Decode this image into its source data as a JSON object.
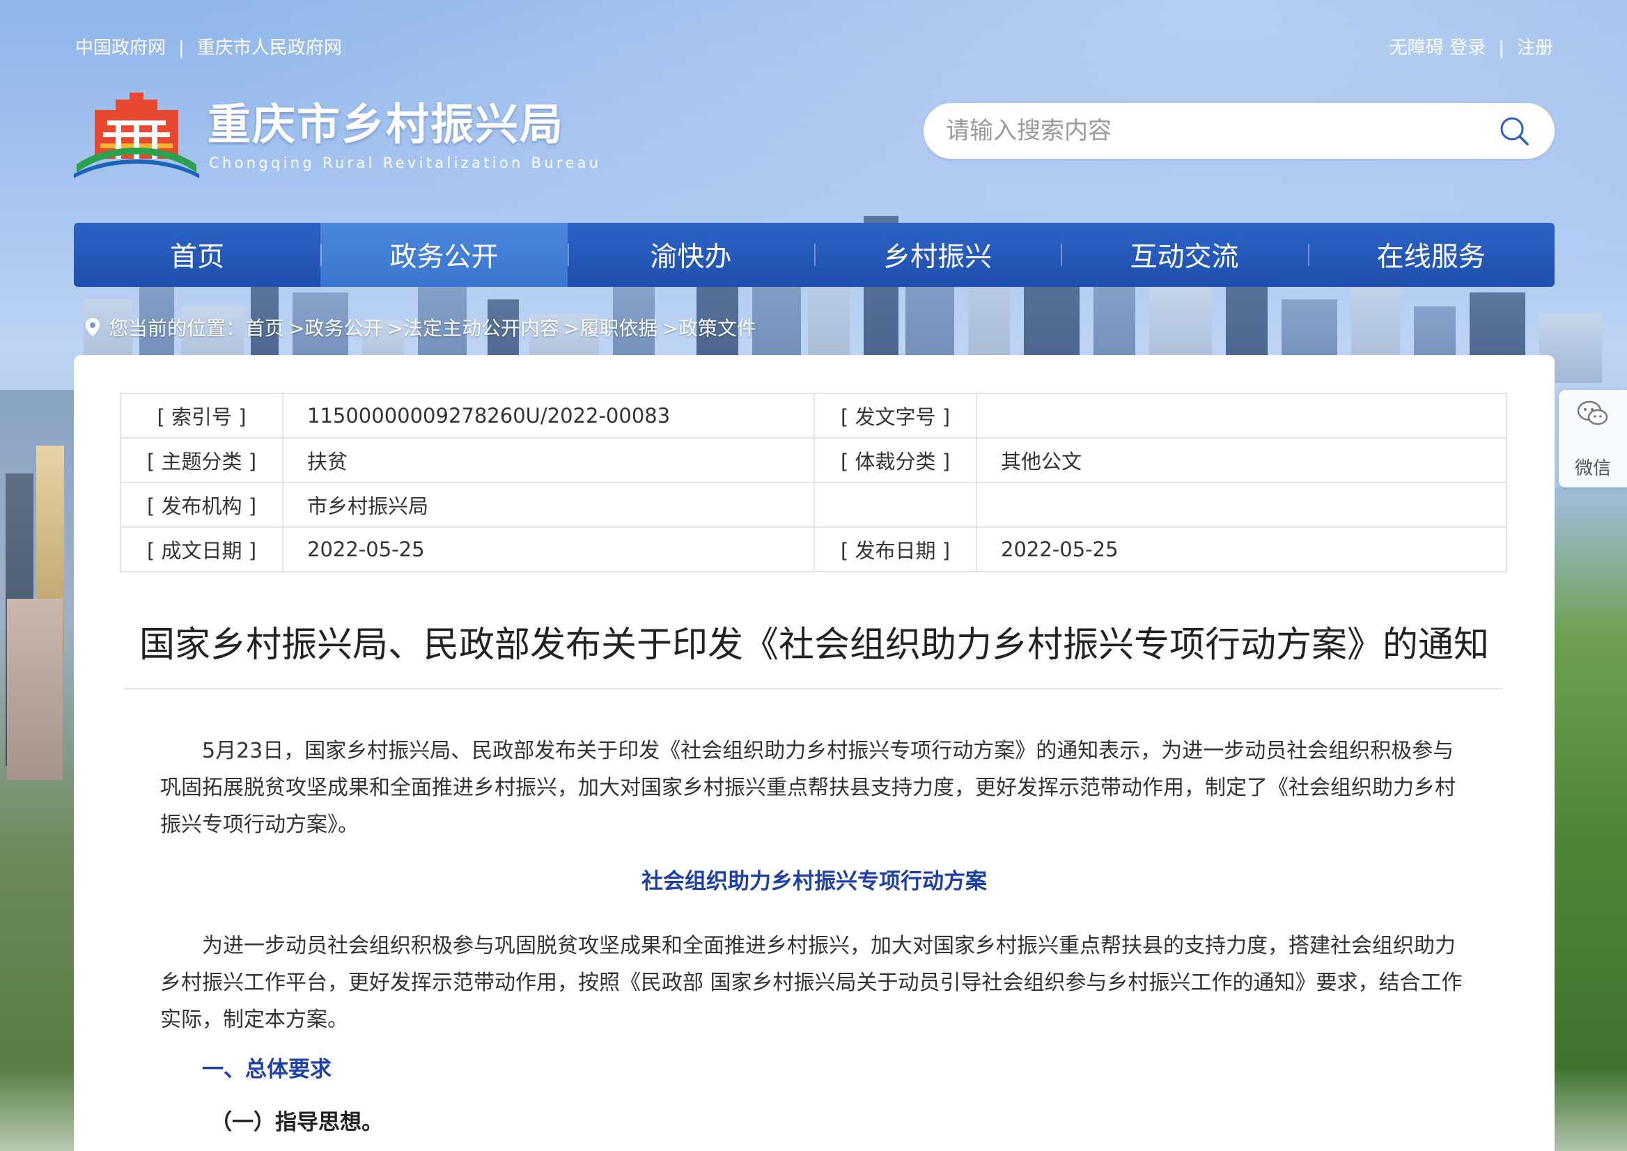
{
  "top_links": {
    "left": [
      "中国政府网",
      "重庆市人民政府网"
    ],
    "right": {
      "accessibility": "无障碍",
      "login": "登录",
      "register": "注册"
    },
    "separator": "|"
  },
  "site": {
    "title": "重庆市乡村振兴局",
    "subtitle": "Chongqing Rural Revitalization Bureau"
  },
  "search": {
    "placeholder": "请输入搜索内容"
  },
  "nav": {
    "items": [
      "首页",
      "政务公开",
      "渝快办",
      "乡村振兴",
      "互动交流",
      "在线服务"
    ],
    "active": "政务公开"
  },
  "breadcrumb": {
    "prefix": "您当前的位置：",
    "items": [
      "首页",
      ">政务公开",
      ">法定主动公开内容",
      ">履职依据",
      ">政策文件"
    ]
  },
  "meta": {
    "index_label": "[ 索引号 ]",
    "index_value": "11500000009278260U/2022-00083",
    "doc_no_label": "[ 发文字号 ]",
    "doc_no_value": "",
    "topic_label": "[ 主题分类 ]",
    "topic_value": "扶贫",
    "genre_label": "[ 体裁分类 ]",
    "genre_value": "其他公文",
    "issuer_label": "[ 发布机构 ]",
    "issuer_value": "市乡村振兴局",
    "written_label": "[ 成文日期 ]",
    "written_value": "2022-05-25",
    "published_label": "[ 发布日期 ]",
    "published_value": "2022-05-25"
  },
  "article": {
    "title": "国家乡村振兴局、民政部发布关于印发《社会组织助力乡村振兴专项行动方案》的通知",
    "paragraph1": "5月23日，国家乡村振兴局、民政部发布关于印发《社会组织助力乡村振兴专项行动方案》的通知表示，为进一步动员社会组织积极参与巩固拓展脱贫攻坚成果和全面推进乡村振兴，加大对国家乡村振兴重点帮扶县支持力度，更好发挥示范带动作用，制定了《社会组织助力乡村振兴专项行动方案》。",
    "plan_title": "社会组织助力乡村振兴专项行动方案",
    "paragraph2": "为进一步动员社会组织积极参与巩固脱贫攻坚成果和全面推进乡村振兴，加大对国家乡村振兴重点帮扶县的支持力度，搭建社会组织助力乡村振兴工作平台，更好发挥示范带动作用，按照《民政部 国家乡村振兴局关于动员引导社会组织参与乡村振兴工作的通知》要求，结合工作实际，制定本方案。",
    "heading1": "一、总体要求",
    "heading2": "（一）指导思想。"
  },
  "wechat": {
    "label": "微信"
  },
  "colors": {
    "nav_bg": "#1f4fae",
    "nav_active": "#3b75cf",
    "section_heading": "#1d3fa8"
  }
}
